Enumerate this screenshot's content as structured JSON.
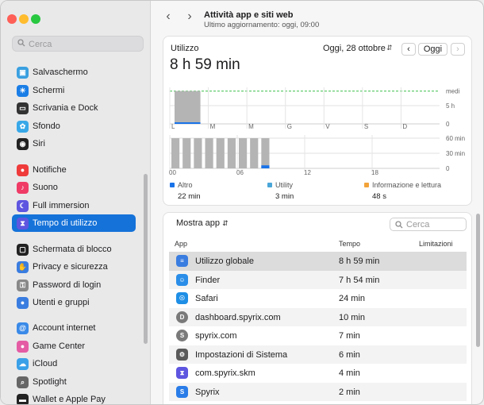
{
  "sidebar": {
    "search_placeholder": "Cerca",
    "items": [
      {
        "label": "Salvaschermo",
        "icon": "screensaver-icon",
        "color": "#3aa0e0"
      },
      {
        "label": "Schermi",
        "icon": "sun-icon",
        "color": "#1a7ee6"
      },
      {
        "label": "Scrivania e Dock",
        "icon": "dock-icon",
        "color": "#333333"
      },
      {
        "label": "Sfondo",
        "icon": "flower-icon",
        "color": "#38a8e8"
      },
      {
        "label": "Siri",
        "icon": "siri-icon",
        "color": "#222222"
      },
      {
        "label": "Notifiche",
        "icon": "bell-icon",
        "color": "#ef3b3b"
      },
      {
        "label": "Suono",
        "icon": "speaker-icon",
        "color": "#ef3b66"
      },
      {
        "label": "Full immersion",
        "icon": "moon-icon",
        "color": "#5e55e0"
      },
      {
        "label": "Tempo di utilizzo",
        "icon": "hourglass-icon",
        "color": "#5e55e0"
      },
      {
        "label": "Schermata di blocco",
        "icon": "lock-screen-icon",
        "color": "#222222"
      },
      {
        "label": "Privacy e sicurezza",
        "icon": "hand-icon",
        "color": "#3a7de0"
      },
      {
        "label": "Password di login",
        "icon": "key-icon",
        "color": "#888888"
      },
      {
        "label": "Utenti e gruppi",
        "icon": "users-icon",
        "color": "#3a7de0"
      },
      {
        "label": "Account internet",
        "icon": "at-icon",
        "color": "#3a8ae8"
      },
      {
        "label": "Game Center",
        "icon": "game-center-icon",
        "color": "#e45ca4"
      },
      {
        "label": "iCloud",
        "icon": "cloud-icon",
        "color": "#3aa0e8"
      },
      {
        "label": "Spotlight",
        "icon": "spotlight-icon",
        "color": "#666666"
      },
      {
        "label": "Wallet e Apple Pay",
        "icon": "wallet-icon",
        "color": "#222222"
      }
    ]
  },
  "header": {
    "title": "Attività app e siti web",
    "subtitle": "Ultimo aggiornamento: oggi, 09:00"
  },
  "usage": {
    "label": "Utilizzo",
    "total": "8 h 59 min",
    "date": "Oggi, 28 ottobre",
    "today_button": "Oggi"
  },
  "chart_data": [
    {
      "type": "bar",
      "categories": [
        "L",
        "M",
        "M",
        "G",
        "V",
        "S",
        "D"
      ],
      "values": [
        8.98,
        0,
        0,
        0,
        0,
        0,
        0
      ],
      "tick_labels_y": [
        "5 h",
        "0"
      ],
      "average_label": "medi",
      "grid": true
    },
    {
      "type": "bar",
      "x_tick_labels": [
        "00",
        "06",
        "12",
        "18"
      ],
      "y_tick_labels": [
        "60 min",
        "30 min",
        "0"
      ],
      "x": [
        0,
        1,
        2,
        3,
        4,
        5,
        6,
        7,
        8
      ],
      "series": [
        {
          "name": "Altro",
          "values": [
            0,
            0,
            0,
            0,
            0,
            0,
            0,
            0,
            6
          ]
        },
        {
          "name": "Utility",
          "values": [
            0,
            0,
            0,
            0,
            0,
            0,
            0,
            0,
            0
          ]
        },
        {
          "name": "Informazione e lettura",
          "values": [
            0,
            0,
            0,
            0,
            0,
            0,
            0,
            0,
            0
          ]
        }
      ],
      "totals": [
        60,
        60,
        60,
        60,
        60,
        60,
        60,
        60,
        60
      ],
      "grid": true
    }
  ],
  "legend": [
    {
      "label": "Altro",
      "value": "22 min",
      "color": "#1a73e8"
    },
    {
      "label": "Utility",
      "value": "3 min",
      "color": "#4aa6d8"
    },
    {
      "label": "Informazione e lettura",
      "value": "48 s",
      "color": "#f2a33a"
    }
  ],
  "apps": {
    "show_label": "Mostra app",
    "search_placeholder": "Cerca",
    "columns": [
      "App",
      "Tempo",
      "Limitazioni"
    ],
    "rows": [
      {
        "name": "Utilizzo globale",
        "time": "8 h 59 min",
        "icon": "layers-icon",
        "color": "#3a7de0"
      },
      {
        "name": "Finder",
        "time": "7 h 54 min",
        "icon": "finder-icon",
        "color": "#2a8ee8"
      },
      {
        "name": "Safari",
        "time": "24 min",
        "icon": "compass-icon",
        "color": "#1f8fe6"
      },
      {
        "name": "dashboard.spyrix.com",
        "time": "10 min",
        "icon": "letter-d-icon",
        "color": "#7a7a7a"
      },
      {
        "name": "spyrix.com",
        "time": "7 min",
        "icon": "letter-s-icon",
        "color": "#7a7a7a"
      },
      {
        "name": "Impostazioni di Sistema",
        "time": "6 min",
        "icon": "gear-icon",
        "color": "#5a5a5a"
      },
      {
        "name": "com.spyrix.skm",
        "time": "4 min",
        "icon": "hourglass-icon",
        "color": "#5e55e0"
      },
      {
        "name": "Spyrix",
        "time": "2 min",
        "icon": "shield-icon",
        "color": "#2a7de8"
      }
    ]
  }
}
